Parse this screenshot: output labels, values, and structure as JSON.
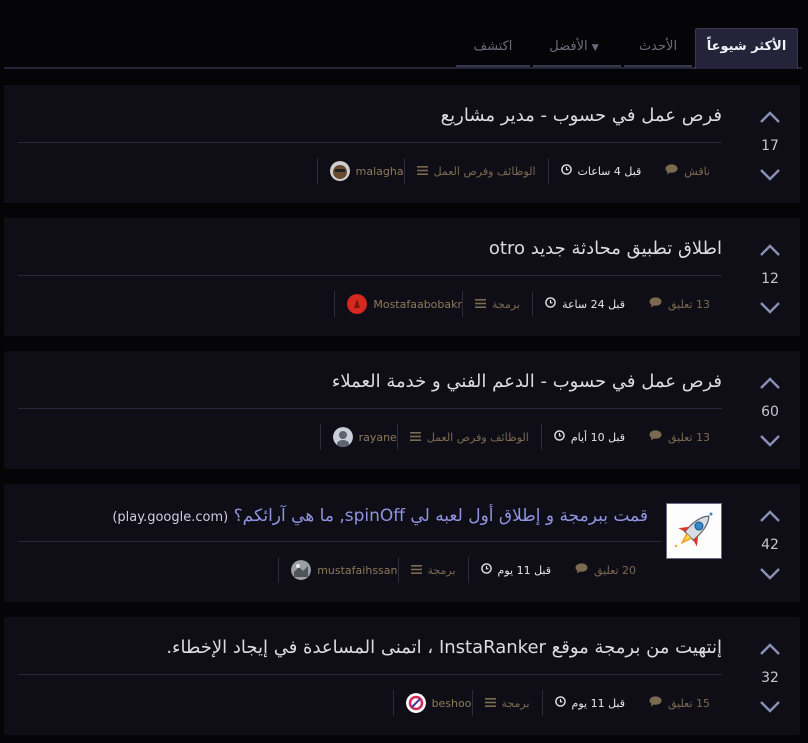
{
  "tabs": [
    {
      "label": "الأكثر شيوعاً",
      "active": true
    },
    {
      "label": "الأحدث",
      "active": false
    },
    {
      "label": "الأفضل",
      "active": false,
      "has_caret": true
    },
    {
      "label": "اكتشف",
      "active": false
    }
  ],
  "posts": [
    {
      "votes": "17",
      "title": "فرص عمل في حسوب - مدير مشاريع",
      "author": "malagha",
      "category": "الوظائف وفرص العمل",
      "time": "قبل 4 ساعات",
      "comments": "ناقش"
    },
    {
      "votes": "12",
      "title": "اطلاق تطبيق محادثة جديد otro",
      "author": "Mostafaabobakr",
      "category": "برمجة",
      "time": "قبل 24 ساعة",
      "comments": "13 تعليق"
    },
    {
      "votes": "60",
      "title": "فرص عمل في حسوب - الدعم الفني و خدمة العملاء",
      "author": "rayane",
      "category": "الوظائف وفرص العمل",
      "time": "قبل 10 أيام",
      "comments": "13 تعليق"
    },
    {
      "votes": "42",
      "title": "قمت ببرمجة و إطلاق أول لعبه لي spinOff, ما هي آرائكم؟",
      "domain": "(play.google.com)",
      "author": "mustafaihssan",
      "category": "برمجة",
      "time": "قبل 11 يوم",
      "comments": "20 تعليق"
    },
    {
      "votes": "32",
      "title": "إنتهيت من برمجة موقع InstaRanker ، اتمنى المساعدة في إيجاد الإخطاء.",
      "author": "beshoo",
      "category": "برمجة",
      "time": "قبل 11 يوم",
      "comments": "15 تعليق"
    }
  ],
  "icons": {
    "upvote": "chevron-up-icon",
    "downvote": "chevron-down-icon",
    "category": "list-icon",
    "time": "clock-icon",
    "comments": "comment-icon",
    "thumbnail": "rocket-icon"
  },
  "colors": {
    "background": "#050407",
    "card": "#0f0e17",
    "accent_arrow": "#8a8fb5",
    "link": "#8f93e0",
    "meta_muted": "#7a6a4f"
  }
}
